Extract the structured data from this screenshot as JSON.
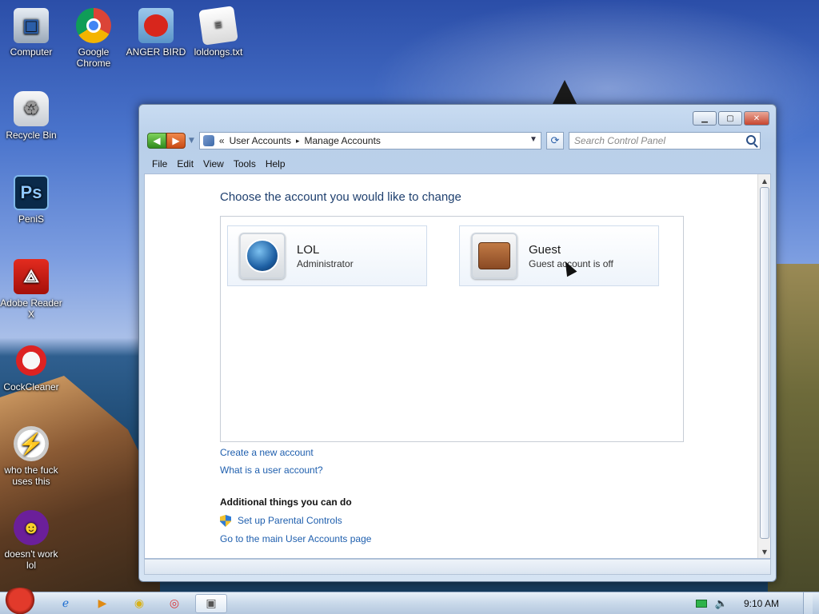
{
  "desktop": {
    "icons": [
      {
        "label": "Computer"
      },
      {
        "label": "Google Chrome"
      },
      {
        "label": "ANGER BIRD"
      },
      {
        "label": "loldongs.txt"
      },
      {
        "label": "Recycle Bin"
      },
      {
        "label": "PeniS"
      },
      {
        "label": "Adobe Reader X"
      },
      {
        "label": "CockCleaner"
      },
      {
        "label": "who the fuck uses this"
      },
      {
        "label": "doesn't work lol"
      }
    ]
  },
  "window": {
    "breadcrumb": {
      "prefix": "«",
      "items": [
        "User Accounts",
        "Manage Accounts"
      ],
      "separator": "▸"
    },
    "search": {
      "placeholder": "Search Control Panel"
    },
    "menu": [
      "File",
      "Edit",
      "View",
      "Tools",
      "Help"
    ],
    "page_title": "Choose the account you would like to change",
    "accounts": [
      {
        "name": "LOL",
        "type": "Administrator"
      },
      {
        "name": "Guest",
        "type": "Guest account is off"
      }
    ],
    "links": {
      "create": "Create a new account",
      "what_is": "What is a user account?"
    },
    "additional": {
      "heading": "Additional things you can do",
      "parental": "Set up Parental Controls",
      "main_page": "Go to the main User Accounts page"
    }
  },
  "taskbar": {
    "clock": "9:10 AM"
  },
  "colors": {
    "link": "#1f5fae",
    "title": "#1e3f6e"
  }
}
